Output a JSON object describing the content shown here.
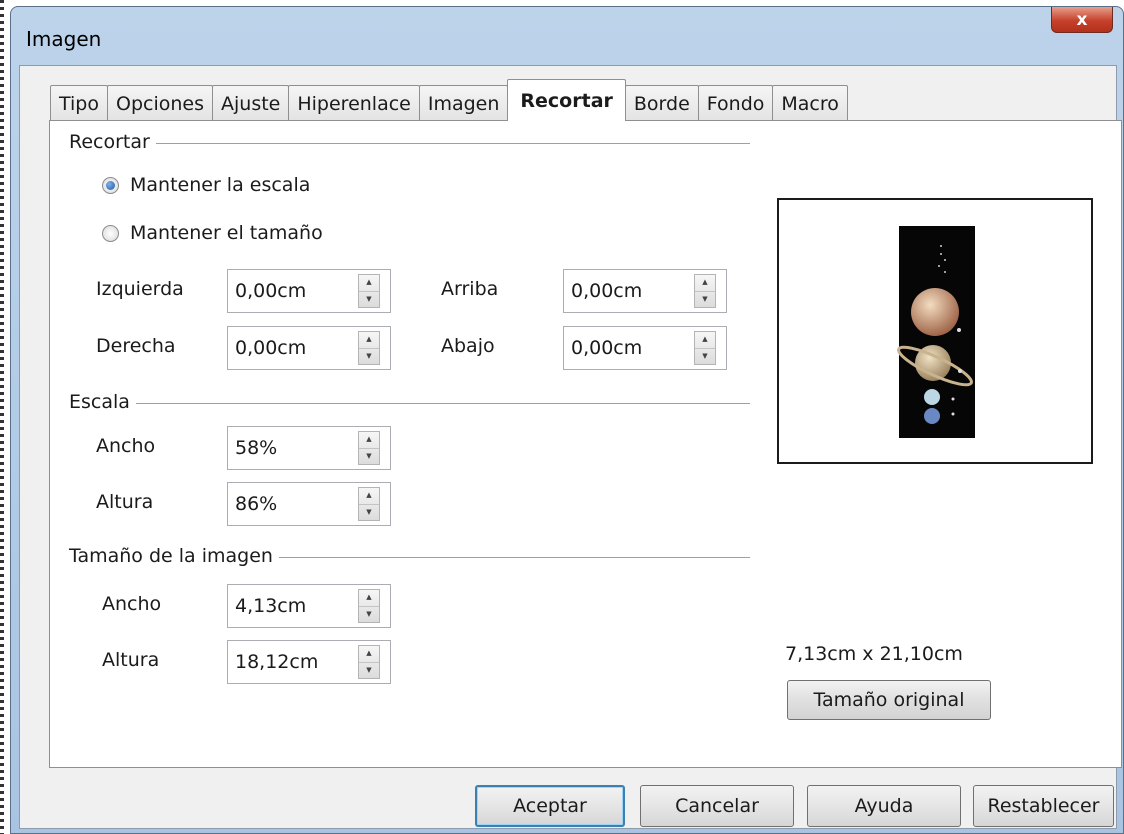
{
  "window": {
    "title": "Imagen",
    "close_glyph": "x"
  },
  "tabs": [
    {
      "label": "Tipo"
    },
    {
      "label": "Opciones"
    },
    {
      "label": "Ajuste"
    },
    {
      "label": "Hiperenlace"
    },
    {
      "label": "Imagen"
    },
    {
      "label": "Recortar",
      "active": true
    },
    {
      "label": "Borde"
    },
    {
      "label": "Fondo"
    },
    {
      "label": "Macro"
    }
  ],
  "crop": {
    "group_title": "Recortar",
    "keep_scale_label": "Mantener la escala",
    "keep_size_label": "Mantener el tamaño",
    "selected": "keep_scale",
    "left_label": "Izquierda",
    "left_value": "0,00cm",
    "right_label": "Derecha",
    "right_value": "0,00cm",
    "top_label": "Arriba",
    "top_value": "0,00cm",
    "bottom_label": "Abajo",
    "bottom_value": "0,00cm"
  },
  "scale": {
    "group_title": "Escala",
    "width_label": "Ancho",
    "width_value": "58%",
    "height_label": "Altura",
    "height_value": "86%"
  },
  "image_size": {
    "group_title": "Tamaño de la imagen",
    "width_label": "Ancho",
    "width_value": "4,13cm",
    "height_label": "Altura",
    "height_value": "18,12cm"
  },
  "original": {
    "size_text": "7,13cm x 21,10cm",
    "button_label": "Tamaño original"
  },
  "buttons": {
    "ok": "Aceptar",
    "cancel": "Cancelar",
    "help": "Ayuda",
    "reset": "Restablecer"
  },
  "colors": {
    "accent": "#3c7fb1",
    "close": "#c5412b",
    "title_bar": "#bcd3ea"
  }
}
